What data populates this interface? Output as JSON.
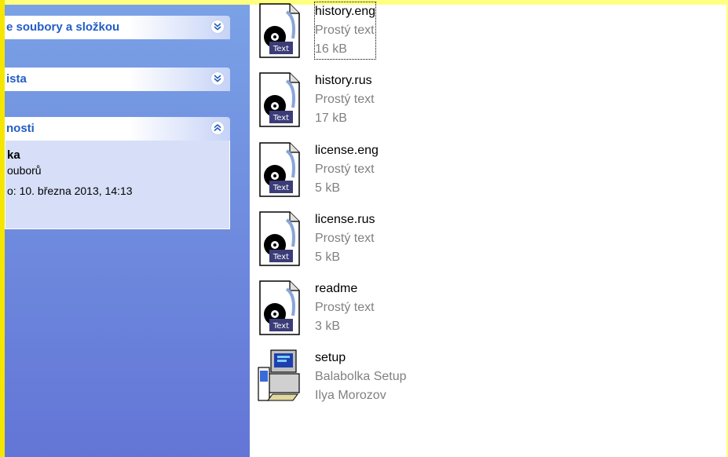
{
  "taskpane": {
    "group1_label": "e soubory a složkou",
    "group2_label": "ista",
    "group3_label": "nosti",
    "details": {
      "title": "ka",
      "subtitle": "ouborů",
      "modified": "o: 10. března 2013, 14:13"
    }
  },
  "files": [
    {
      "name": "history.eng",
      "type": "Prostý text",
      "info": "16 kB",
      "icon": "text-file-icon"
    },
    {
      "name": "history.rus",
      "type": "Prostý text",
      "info": "17 kB",
      "icon": "text-file-icon"
    },
    {
      "name": "license.eng",
      "type": "Prostý text",
      "info": "5 kB",
      "icon": "text-file-icon"
    },
    {
      "name": "license.rus",
      "type": "Prostý text",
      "info": "5 kB",
      "icon": "text-file-icon"
    },
    {
      "name": "readme",
      "type": "Prostý text",
      "info": "3 kB",
      "icon": "text-file-icon"
    },
    {
      "name": "setup",
      "type": "Balabolka Setup",
      "info": "Ilya Morozov",
      "icon": "installer-icon"
    }
  ],
  "icon_badge": "Text",
  "colors": {
    "frame": "#ffff80",
    "pane_top": "#7aa1e6",
    "pane_bottom": "#6375d6",
    "header_text": "#215dc6",
    "details_bg": "#d6dff7"
  }
}
